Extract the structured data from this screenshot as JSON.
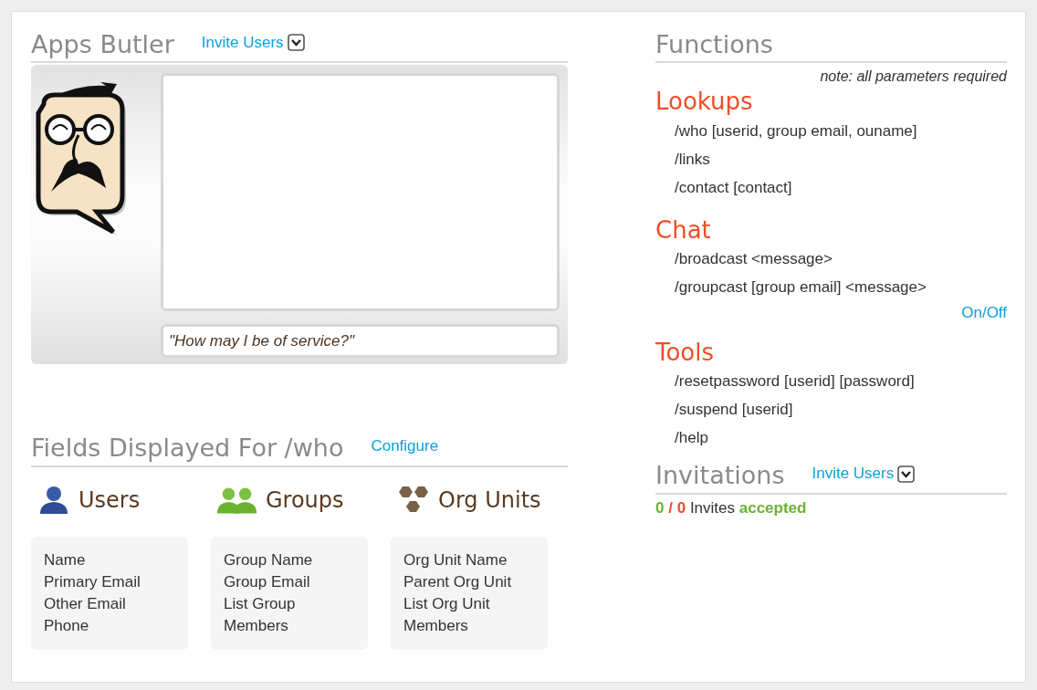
{
  "butler": {
    "title": "Apps Butler",
    "invite_link": "Invite Users",
    "message_field": {
      "value": "\"How may I be of service?\""
    }
  },
  "fields_displayed": {
    "title": "Fields Displayed For /who",
    "configure_link": "Configure",
    "groups": [
      {
        "kind": "users",
        "title": "Users",
        "fields": [
          "Name",
          "Primary Email",
          "Other Email",
          "Phone"
        ]
      },
      {
        "kind": "groups",
        "title": "Groups",
        "fields": [
          "Group Name",
          "Group Email",
          "List Group",
          "Members"
        ]
      },
      {
        "kind": "org_units",
        "title": "Org Units",
        "fields": [
          "Org Unit Name",
          "Parent Org Unit",
          "List Org Unit",
          "Members"
        ]
      }
    ]
  },
  "functions": {
    "title": "Functions",
    "note": "note: all parameters required",
    "categories": [
      {
        "title": "Lookups",
        "commands": [
          "/who [userid, group email, ouname]",
          "/links",
          "/contact [contact]"
        ]
      },
      {
        "title": "Chat",
        "commands": [
          "/broadcast <message>",
          "/groupcast [group email] <message>"
        ],
        "toggle_link": "On/Off"
      },
      {
        "title": "Tools",
        "commands": [
          "/resetpassword [userid] [password]",
          "/suspend [userid]",
          "/help"
        ]
      }
    ]
  },
  "invitations": {
    "title": "Invitations",
    "invite_link": "Invite Users",
    "accepted_count": "0",
    "separator": "/",
    "total_count": "0",
    "label": "Invites",
    "status": "accepted"
  }
}
